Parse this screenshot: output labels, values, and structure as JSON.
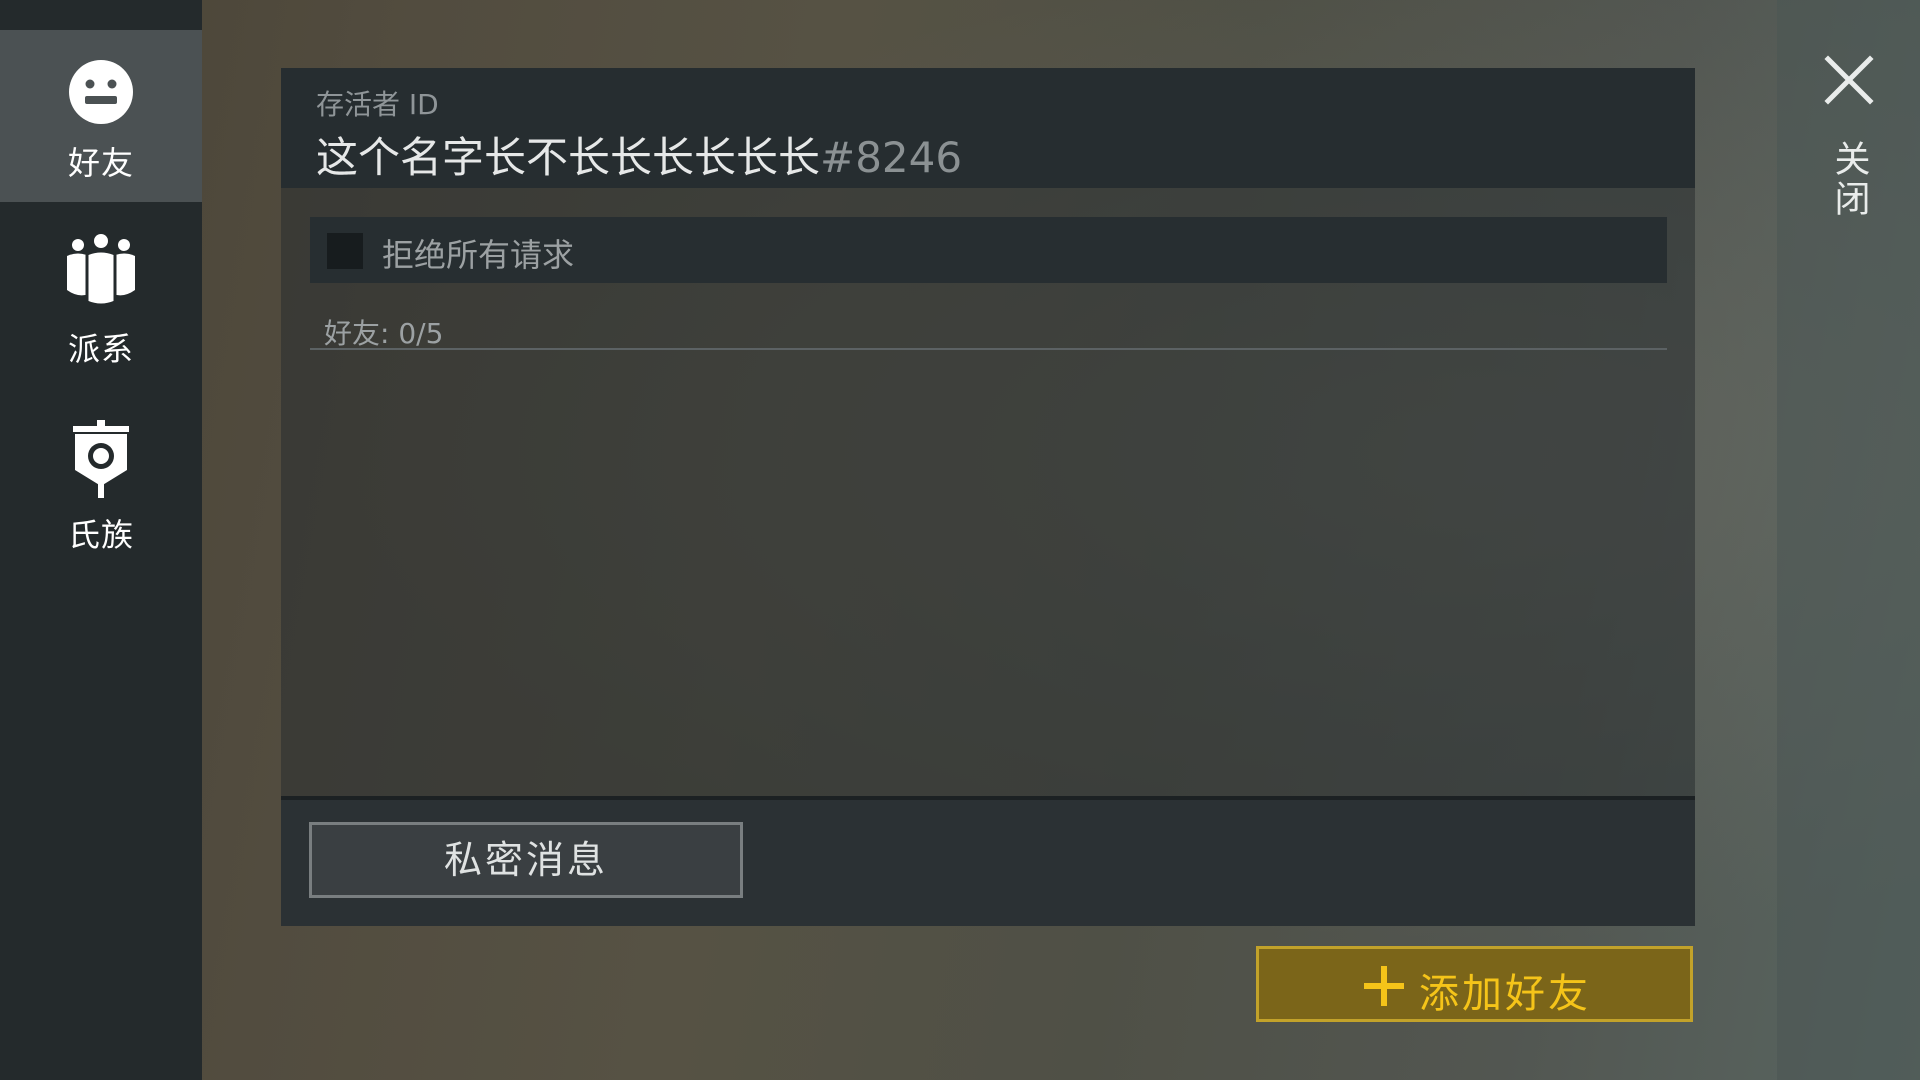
{
  "sidebar": {
    "items": [
      {
        "label": "好友",
        "icon": "smiley-icon",
        "active": true
      },
      {
        "label": "派系",
        "icon": "group-icon",
        "active": false
      },
      {
        "label": "氏族",
        "icon": "banner-icon",
        "active": false
      }
    ]
  },
  "header": {
    "id_caption": "存活者 ID",
    "player_name": "这个名字长不长长长长长长",
    "player_tag": "#8246"
  },
  "reject_all": {
    "label": "拒绝所有请求",
    "checked": false
  },
  "friends": {
    "count_text": "好友: 0/5",
    "items": []
  },
  "footer": {
    "private_message_label": "私密消息"
  },
  "add_friend": {
    "label": "添加好友"
  },
  "close": {
    "label": "关闭"
  },
  "colors": {
    "accent_gold": "#f5c419",
    "button_gold_bg": "#7b6519",
    "sidebar_bg": "#242a2c",
    "sidebar_active_bg": "#4b5153"
  }
}
